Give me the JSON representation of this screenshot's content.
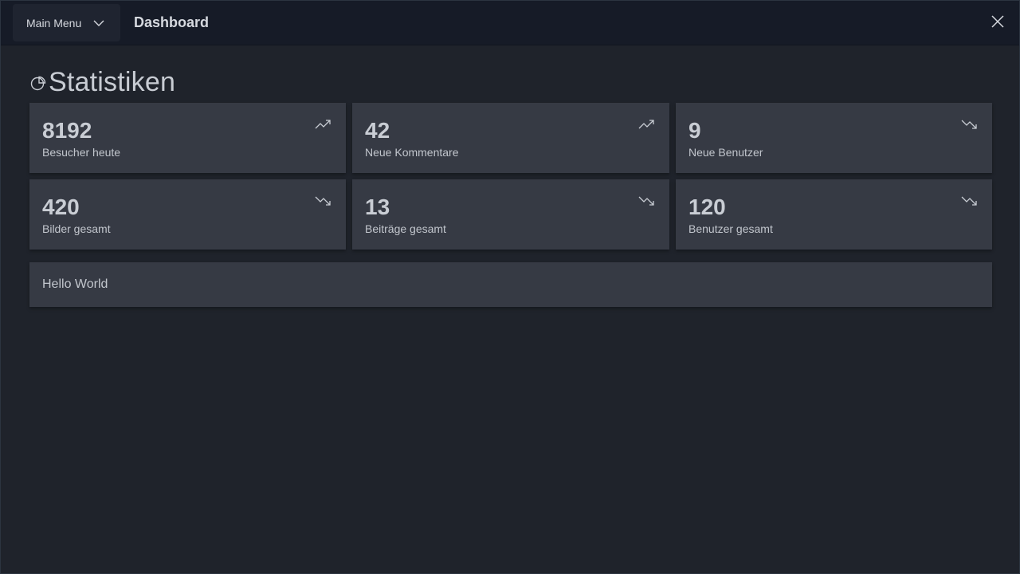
{
  "header": {
    "menu_label": "Main Menu",
    "title": "Dashboard"
  },
  "section": {
    "title": "Statistiken"
  },
  "stats": [
    {
      "value": "8192",
      "label": "Besucher heute",
      "trend": "up"
    },
    {
      "value": "42",
      "label": "Neue Kommentare",
      "trend": "up"
    },
    {
      "value": "9",
      "label": "Neue Benutzer",
      "trend": "down"
    },
    {
      "value": "420",
      "label": "Bilder gesamt",
      "trend": "down"
    },
    {
      "value": "13",
      "label": "Beiträge gesamt",
      "trend": "down"
    },
    {
      "value": "120",
      "label": "Benutzer gesamt",
      "trend": "down"
    }
  ],
  "message": {
    "text": "Hello World"
  },
  "icons": {
    "menu": "chevron-down-icon",
    "close": "close-icon",
    "section": "pie-chart-icon",
    "trend_up": "trending-up-icon",
    "trend_down": "trending-down-icon"
  },
  "colors": {
    "background": "#1f232b",
    "titlebar": "#161b27",
    "card": "#363a44",
    "text": "#c9cdd4"
  }
}
